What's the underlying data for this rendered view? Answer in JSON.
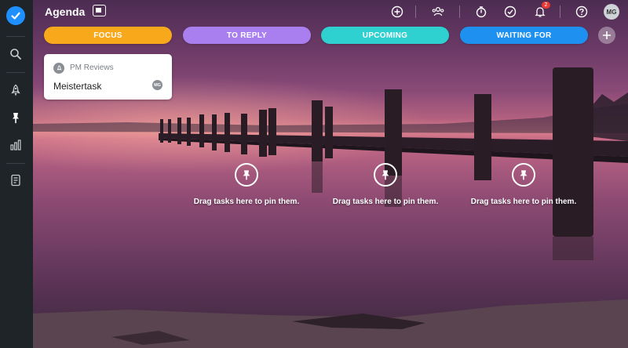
{
  "header": {
    "title": "Agenda",
    "avatar_initials": "MG",
    "notification_count": "2"
  },
  "sidebar": {
    "items": [
      {
        "icon": "search-icon"
      },
      {
        "icon": "rocket-icon"
      },
      {
        "icon": "pin-icon"
      },
      {
        "icon": "bar-chart-icon"
      },
      {
        "icon": "notes-icon"
      }
    ]
  },
  "columns": [
    {
      "label": "FOCUS",
      "color": "#f7a81b"
    },
    {
      "label": "TO REPLY",
      "color": "#a97ff0"
    },
    {
      "label": "UPCOMING",
      "color": "#2fd0d0"
    },
    {
      "label": "WAITING FOR",
      "color": "#1e90f0"
    }
  ],
  "card": {
    "project": "PM Reviews",
    "title": "Meistertask",
    "assignee": "MG"
  },
  "pin_zones": [
    {
      "text": "Drag tasks here to pin them."
    },
    {
      "text": "Drag tasks here to pin them."
    },
    {
      "text": "Drag tasks here to pin them."
    }
  ]
}
